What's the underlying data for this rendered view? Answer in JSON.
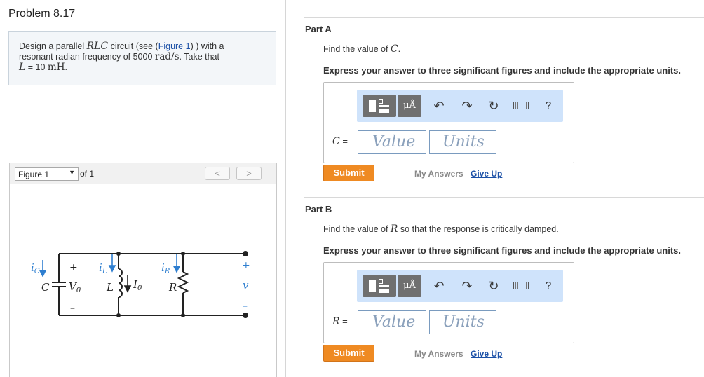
{
  "problem": {
    "title": "Problem 8.17",
    "text_1": "Design a parallel ",
    "var_rlc": "RLC",
    "text_2": " circuit (see (",
    "figure_link": "Figure 1",
    "text_3": ") ) with a",
    "text_4": "resonant radian frequency of 5000 ",
    "unit_rad": "rad/s",
    "text_5": ". Take that",
    "var_l": "L",
    "text_6": " = 10 ",
    "unit_mh": "mH",
    "text_7": "."
  },
  "figure": {
    "select_value": "Figure 1",
    "of_label": "of 1",
    "prev_label": "<",
    "next_label": ">",
    "circuit_labels": {
      "ic": "i",
      "ic_sub": "C",
      "c": "C",
      "plus_left": "+",
      "v0": "V",
      "v0_sub": "0",
      "minus_left": "–",
      "il": "i",
      "il_sub": "L",
      "l": "L",
      "i0": "I",
      "i0_sub": "0",
      "ir": "i",
      "ir_sub": "R",
      "r": "R",
      "plus_right": "+",
      "v": "v",
      "minus_right": "–"
    }
  },
  "parts": [
    {
      "label": "Part A",
      "question_pre": "Find the value of ",
      "question_var": "C",
      "question_post": ".",
      "instruction": "Express your answer to three significant figures and include the appropriate units.",
      "var_label": "C",
      "var_eq": " =",
      "value_placeholder": "Value",
      "units_placeholder": "Units",
      "units_button": "μÅ",
      "help": "?",
      "submit": "Submit",
      "my_answers": "My Answers",
      "give_up": "Give Up"
    },
    {
      "label": "Part B",
      "question_pre": "Find the value of ",
      "question_var": "R",
      "question_post": " so that the response is critically damped.",
      "instruction": "Express your answer to three significant figures and include the appropriate units.",
      "var_label": "R",
      "var_eq": " =",
      "value_placeholder": "Value",
      "units_placeholder": "Units",
      "units_button": "μÅ",
      "help": "?",
      "submit": "Submit",
      "my_answers": "My Answers",
      "give_up": "Give Up"
    }
  ],
  "colors": {
    "submit_orange": "#ef8a22",
    "toolbar_blue": "#cfe3fb",
    "link_blue": "#1a4fa6",
    "circuit_blue": "#2f7fd0"
  },
  "icons": [
    "templates-icon",
    "units-icon",
    "undo-icon",
    "redo-icon",
    "reset-icon",
    "keyboard-icon",
    "help-icon"
  ]
}
